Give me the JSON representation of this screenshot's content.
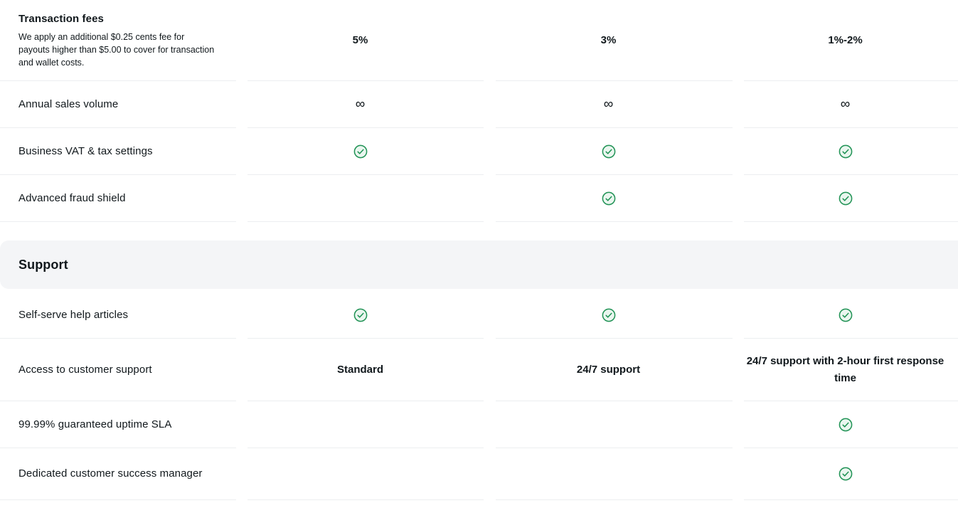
{
  "theme": {
    "check_color": "#1f9254",
    "check_fill": "#eaf6ef",
    "divider_color": "#eceef0",
    "band_background": "#f4f5f7",
    "text_color": "#11181c"
  },
  "icons": {
    "check": "check-circle-icon",
    "infinity": "∞"
  },
  "sections": [
    {
      "id": "pricing-continued",
      "label": "",
      "rows": [
        {
          "title": "Transaction fees",
          "title_bold": true,
          "description": "We apply an additional $0.25 cents fee for payouts higher than $5.00 to cover for transaction and wallet costs.",
          "values": [
            {
              "type": "text",
              "text": "5%"
            },
            {
              "type": "text",
              "text": "3%"
            },
            {
              "type": "text",
              "text": "1%-2%"
            }
          ]
        },
        {
          "title": "Annual sales volume",
          "title_bold": false,
          "description": "",
          "values": [
            {
              "type": "infinity",
              "text": "∞"
            },
            {
              "type": "infinity",
              "text": "∞"
            },
            {
              "type": "infinity",
              "text": "∞"
            }
          ]
        },
        {
          "title": "Business VAT & tax settings",
          "title_bold": false,
          "description": "",
          "values": [
            {
              "type": "check",
              "text": ""
            },
            {
              "type": "check",
              "text": ""
            },
            {
              "type": "check",
              "text": ""
            }
          ]
        },
        {
          "title": "Advanced fraud shield",
          "title_bold": false,
          "description": "",
          "values": [
            {
              "type": "empty",
              "text": ""
            },
            {
              "type": "check",
              "text": ""
            },
            {
              "type": "check",
              "text": ""
            }
          ]
        }
      ]
    },
    {
      "id": "support",
      "label": "Support",
      "rows": [
        {
          "title": "Self-serve help articles",
          "title_bold": false,
          "description": "",
          "values": [
            {
              "type": "check",
              "text": ""
            },
            {
              "type": "check",
              "text": ""
            },
            {
              "type": "check",
              "text": ""
            }
          ]
        },
        {
          "title": "Access to customer support",
          "title_bold": false,
          "description": "",
          "values": [
            {
              "type": "text",
              "text": "Standard"
            },
            {
              "type": "text",
              "text": "24/7 support"
            },
            {
              "type": "text",
              "text": "24/7 support with 2-hour first response time"
            }
          ]
        },
        {
          "title": "99.99% guaranteed uptime SLA",
          "title_bold": false,
          "description": "",
          "values": [
            {
              "type": "empty",
              "text": ""
            },
            {
              "type": "empty",
              "text": ""
            },
            {
              "type": "check",
              "text": ""
            }
          ]
        },
        {
          "title": "Dedicated customer success manager",
          "title_bold": false,
          "description": "",
          "values": [
            {
              "type": "empty",
              "text": ""
            },
            {
              "type": "empty",
              "text": ""
            },
            {
              "type": "check",
              "text": ""
            }
          ]
        }
      ]
    }
  ]
}
